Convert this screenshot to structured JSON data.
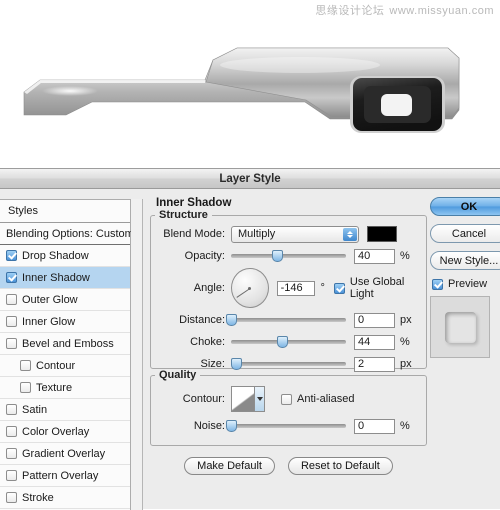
{
  "watermark": {
    "cn": "思缘设计论坛",
    "url": "www.missyuan.com"
  },
  "dialog": {
    "title": "Layer Style"
  },
  "styles_panel": {
    "header": "Styles",
    "blending_options": "Blending Options: Custom",
    "items": [
      {
        "label": "Drop Shadow",
        "checked": true,
        "selected": false,
        "indent": false
      },
      {
        "label": "Inner Shadow",
        "checked": true,
        "selected": true,
        "indent": false
      },
      {
        "label": "Outer Glow",
        "checked": false,
        "selected": false,
        "indent": false
      },
      {
        "label": "Inner Glow",
        "checked": false,
        "selected": false,
        "indent": false
      },
      {
        "label": "Bevel and Emboss",
        "checked": false,
        "selected": false,
        "indent": false
      },
      {
        "label": "Contour",
        "checked": false,
        "selected": false,
        "indent": true
      },
      {
        "label": "Texture",
        "checked": false,
        "selected": false,
        "indent": true
      },
      {
        "label": "Satin",
        "checked": false,
        "selected": false,
        "indent": false
      },
      {
        "label": "Color Overlay",
        "checked": false,
        "selected": false,
        "indent": false
      },
      {
        "label": "Gradient Overlay",
        "checked": false,
        "selected": false,
        "indent": false
      },
      {
        "label": "Pattern Overlay",
        "checked": false,
        "selected": false,
        "indent": false
      },
      {
        "label": "Stroke",
        "checked": false,
        "selected": false,
        "indent": false
      }
    ]
  },
  "panel": {
    "title": "Inner Shadow",
    "structure": {
      "legend": "Structure",
      "blend_mode_label": "Blend Mode:",
      "blend_mode_value": "Multiply",
      "color_swatch": "#000000",
      "opacity_label": "Opacity:",
      "opacity_value": "40",
      "opacity_unit": "%",
      "opacity_pct": 40,
      "angle_label": "Angle:",
      "angle_value": "-146",
      "angle_unit": "°",
      "angle_deg": -146,
      "use_global_light_label": "Use Global Light",
      "use_global_light": true,
      "distance_label": "Distance:",
      "distance_value": "0",
      "distance_unit": "px",
      "distance_pct": 0,
      "choke_label": "Choke:",
      "choke_value": "44",
      "choke_unit": "%",
      "choke_pct": 44,
      "size_label": "Size:",
      "size_value": "2",
      "size_unit": "px",
      "size_pct": 4
    },
    "quality": {
      "legend": "Quality",
      "contour_label": "Contour:",
      "anti_aliased_label": "Anti-aliased",
      "anti_aliased": false,
      "noise_label": "Noise:",
      "noise_value": "0",
      "noise_unit": "%",
      "noise_pct": 0
    },
    "make_default": "Make Default",
    "reset_to_default": "Reset to Default"
  },
  "actions": {
    "ok": "OK",
    "cancel": "Cancel",
    "new_style": "New Style...",
    "preview_label": "Preview",
    "preview_checked": true
  }
}
